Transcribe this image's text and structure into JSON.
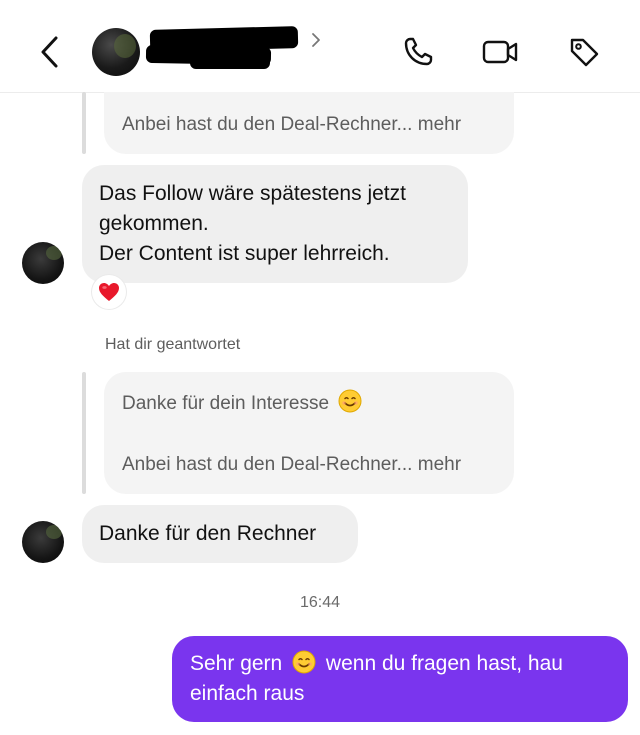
{
  "header": {
    "back_icon": "chevron-left-icon",
    "call_icon": "phone-icon",
    "video_icon": "video-camera-icon",
    "tag_icon": "tag-icon"
  },
  "thread": {
    "quote_top": {
      "preview": "Anbei hast du den Deal-Rechner... mehr"
    },
    "message_1": {
      "lines": [
        "Das Follow wäre spätestens jetzt",
        "gekommen.",
        "Der Content ist super lehrreich."
      ],
      "reaction": "❤️"
    },
    "reply_label": "Hat dir geantwortet",
    "quote_reply": {
      "line1": "Danke für dein Interesse",
      "emoji": "smiling-face-emoji",
      "preview": "Anbei hast du den Deal-Rechner... mehr"
    },
    "message_2": {
      "text": "Danke für den Rechner"
    },
    "timestamp": "16:44",
    "outgoing": {
      "part1": "Sehr gern",
      "part2": "wenn du fragen hast, hau",
      "part3": "einfach raus",
      "emoji": "smiling-face-emoji"
    }
  },
  "colors": {
    "outgoing_bubble": "#7a35ee",
    "incoming_bubble": "#efefef",
    "quote_bubble": "#f4f4f4"
  }
}
